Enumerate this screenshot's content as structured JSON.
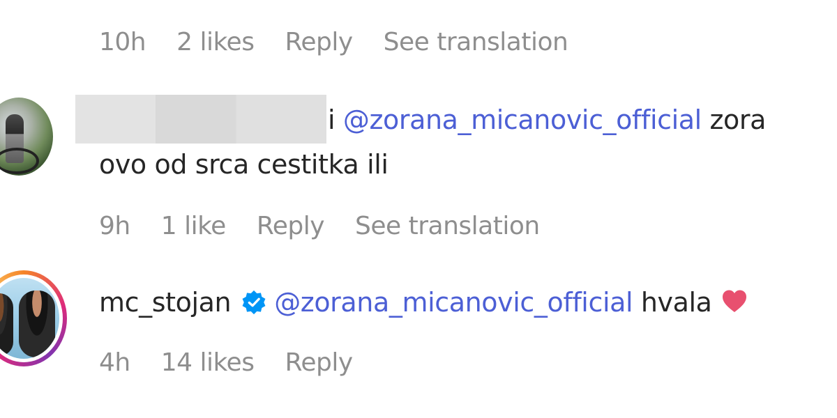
{
  "comment0": {
    "time": "10h",
    "likes": "2 likes",
    "reply": "Reply",
    "translate": "See translation"
  },
  "comment1": {
    "prefix": "i",
    "mention": "@zorana_micanovic_official",
    "text_after": "zora",
    "line2": "ovo od srca cestitka ili",
    "time": "9h",
    "likes": "1 like",
    "reply": "Reply",
    "translate": "See translation"
  },
  "comment2": {
    "username": "mc_stojan",
    "mention": "@zorana_micanovic_official",
    "text": "hvala",
    "time": "4h",
    "likes": "14 likes",
    "reply": "Reply"
  },
  "colors": {
    "mention": "#4c5fd5",
    "meta": "#8e8e8e",
    "verified": "#0095f6",
    "heart": "#e8506f"
  },
  "icons": [
    "avatar",
    "verified-badge-icon",
    "heart-emoji-icon"
  ]
}
